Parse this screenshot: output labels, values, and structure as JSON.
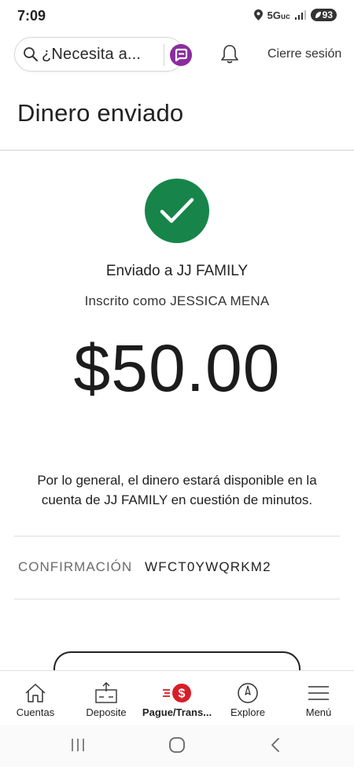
{
  "status_bar": {
    "time": "7:09",
    "network": "5G",
    "network_suffix": "uc",
    "battery": "93"
  },
  "header": {
    "search_placeholder": "¿Necesita a...",
    "logout_label": "Cierre sesión"
  },
  "page": {
    "title": "Dinero enviado"
  },
  "confirmation": {
    "sent_to": "Enviado a JJ FAMILY",
    "registered_as": "Inscrito como JESSICA MENA",
    "amount": "$50.00",
    "availability_message": "Por lo general, el dinero estará disponible en la cuenta de JJ FAMILY en cuestión de minutos.",
    "confirmation_label": "CONFIRMACIÓN",
    "confirmation_code": "WFCT0YWQRKM2"
  },
  "tabbar": {
    "items": [
      {
        "label": "Cuentas",
        "icon": "home-icon"
      },
      {
        "label": "Deposite",
        "icon": "deposit-icon"
      },
      {
        "label": "Pague/Trans...",
        "icon": "pay-transfer-icon",
        "active": true
      },
      {
        "label": "Explore",
        "icon": "compass-icon"
      },
      {
        "label": "Menú",
        "icon": "hamburger-menu-icon"
      }
    ]
  },
  "colors": {
    "success_green": "#17854a",
    "accent_red": "#d71e28",
    "assistant_purple": "#8b2c9e"
  }
}
